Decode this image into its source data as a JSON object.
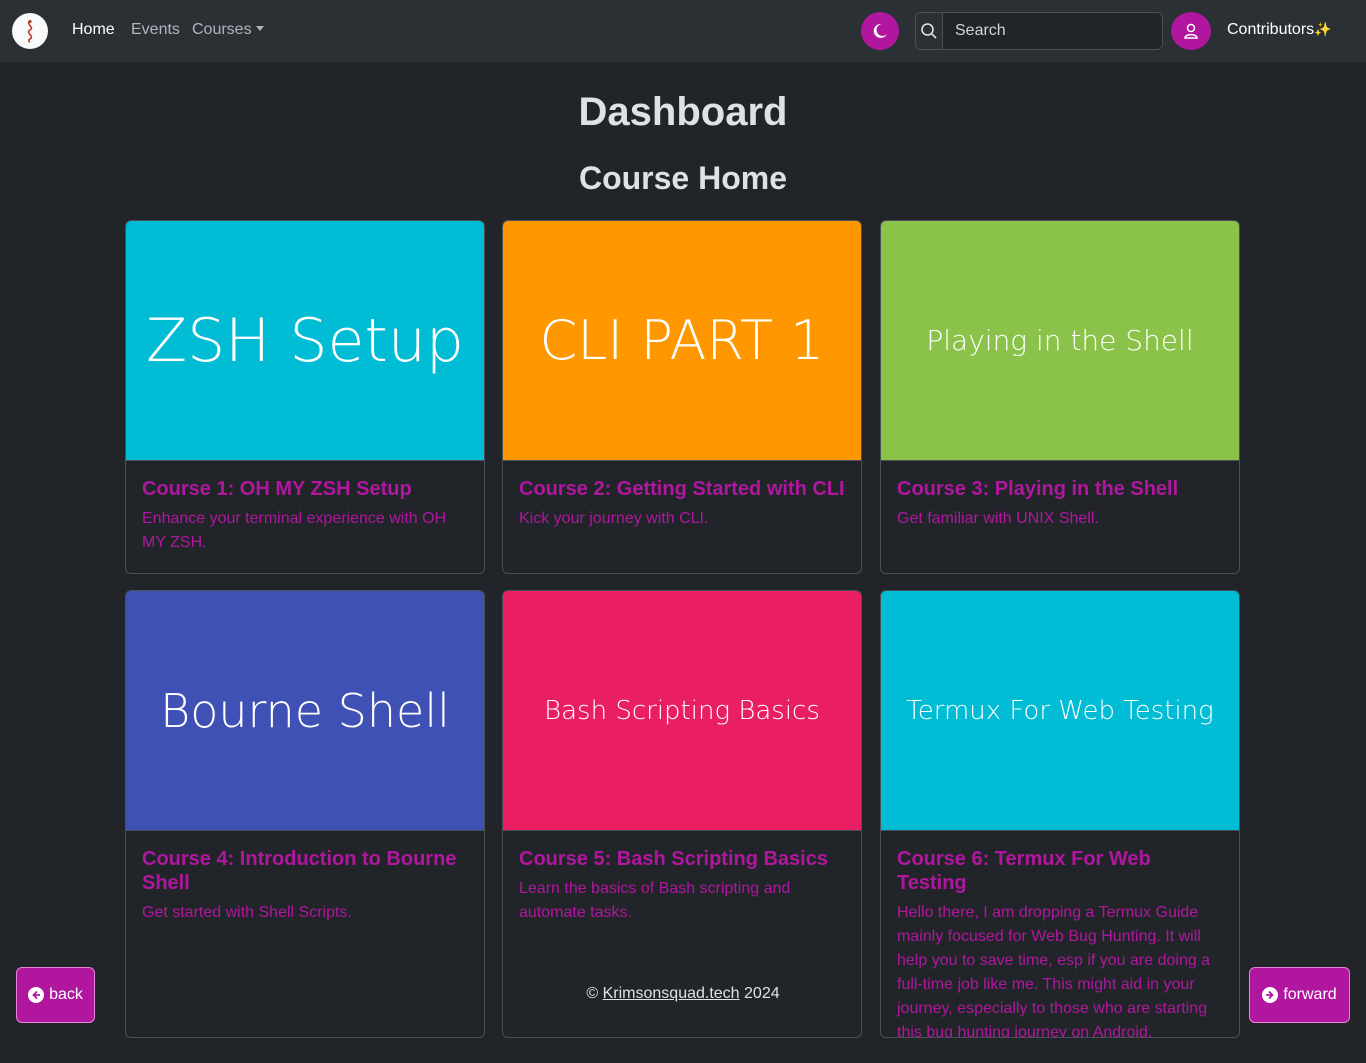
{
  "navbar": {
    "logo_icon": "snake-logo-icon",
    "links": [
      {
        "label": "Home",
        "active": true
      },
      {
        "label": "Events",
        "active": false
      },
      {
        "label": "Courses",
        "active": false
      }
    ],
    "theme_icon": "moon-icon",
    "search": {
      "placeholder": "Search",
      "value": ""
    },
    "user_icon": "user-icon",
    "contributors_label": "Contributors",
    "contributors_emoji": "✨"
  },
  "page_title": "Dashboard",
  "section_title": "Course Home",
  "cards": [
    {
      "image_text": "ZSH Setup",
      "color": "#00bcd4",
      "title": "Course 1: OH MY ZSH Setup",
      "text": "Enhance your terminal experience with OH MY ZSH."
    },
    {
      "image_text": "CLI PART 1",
      "color": "#ff9800",
      "title": "Course 2: Getting Started with CLI",
      "text": "Kick your journey with CLI."
    },
    {
      "image_text": "Playing in the Shell",
      "color": "#8bc34a",
      "title": "Course 3: Playing in the Shell",
      "text": "Get familiar with UNIX Shell."
    },
    {
      "image_text": "Bourne Shell",
      "color": "#3f51b5",
      "title": "Course 4: Introduction to Bourne Shell",
      "text": "Get started with Shell Scripts."
    },
    {
      "image_text": "Bash Scripting Basics",
      "color": "#e91e63",
      "title": "Course 5: Bash Scripting Basics",
      "text": "Learn the basics of Bash scripting and automate tasks."
    },
    {
      "image_text": "Termux For Web Testing",
      "color": "#00bcd4",
      "title": "Course 6: Termux For Web Testing",
      "text": "Hello there, I am dropping a Termux Guide mainly focused for Web Bug Hunting. It will help you to save time, esp if you are doing a full-time job like me. This might aid in your journey, especially to those who are starting this bug hunting journey on Android."
    }
  ],
  "footer": {
    "copyright": "©",
    "link": "Krimsonsquad.tech",
    "year": "2024"
  },
  "back_button": {
    "label": "back",
    "icon": "arrow-left-circle-icon"
  },
  "forward_button": {
    "label": "forward",
    "icon": "arrow-right-circle-icon"
  },
  "colors": {
    "accent": "#b0179e",
    "background": "#212529",
    "navbar": "#2b3035"
  }
}
